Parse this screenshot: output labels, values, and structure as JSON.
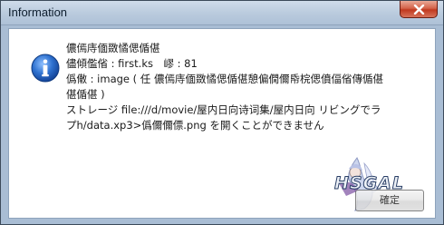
{
  "window": {
    "title": "Information"
  },
  "icons": {
    "message_icon": "information-icon",
    "close_icon": "close-icon"
  },
  "message": {
    "lines": [
      "儂傿庤偭敪憰偲偱偡",
      "儘傾儖偗 : first.ks　嵺 : 81",
      "僞僌 : image ( 任 儂傿庤偭敪憰偲偱偡憩偏僩儞帋梡偲僨偪偗傳偱偡",
      "偡偱偡 )",
      "ストレージ file:///d/movie/屋内日向诗词集/屋内日向 リビングでラ",
      "プh/data.xp3>僞儞儞僄.png を開くことができません"
    ]
  },
  "buttons": {
    "ok_label": "確定"
  },
  "watermark": {
    "text": "HSGAL"
  },
  "colors": {
    "title_bar": "#b9cadd",
    "close_button": "#c0391f",
    "info_icon": "#1e5fbf"
  }
}
